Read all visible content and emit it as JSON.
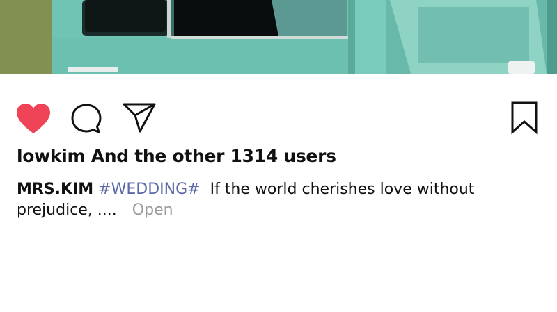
{
  "post": {
    "photo_name": "teal vintage car photo",
    "liked": true,
    "likes_text": "lowkim And the other 1314 users",
    "caption": {
      "username": "MRS.KIM",
      "hashtag": "#WEDDING#",
      "text_line1": "If the world cherishes love without",
      "text_line2": "prejudice, ....",
      "more_label": "Open"
    }
  },
  "icons": {
    "like": "heart-icon",
    "comment": "comment-icon",
    "share": "send-icon",
    "save": "bookmark-icon"
  },
  "colors": {
    "like_red": "#ef4457",
    "hashtag": "#5b6aa6",
    "more_gray": "#9a9a9a",
    "car_teal": "#6ec6b5"
  }
}
